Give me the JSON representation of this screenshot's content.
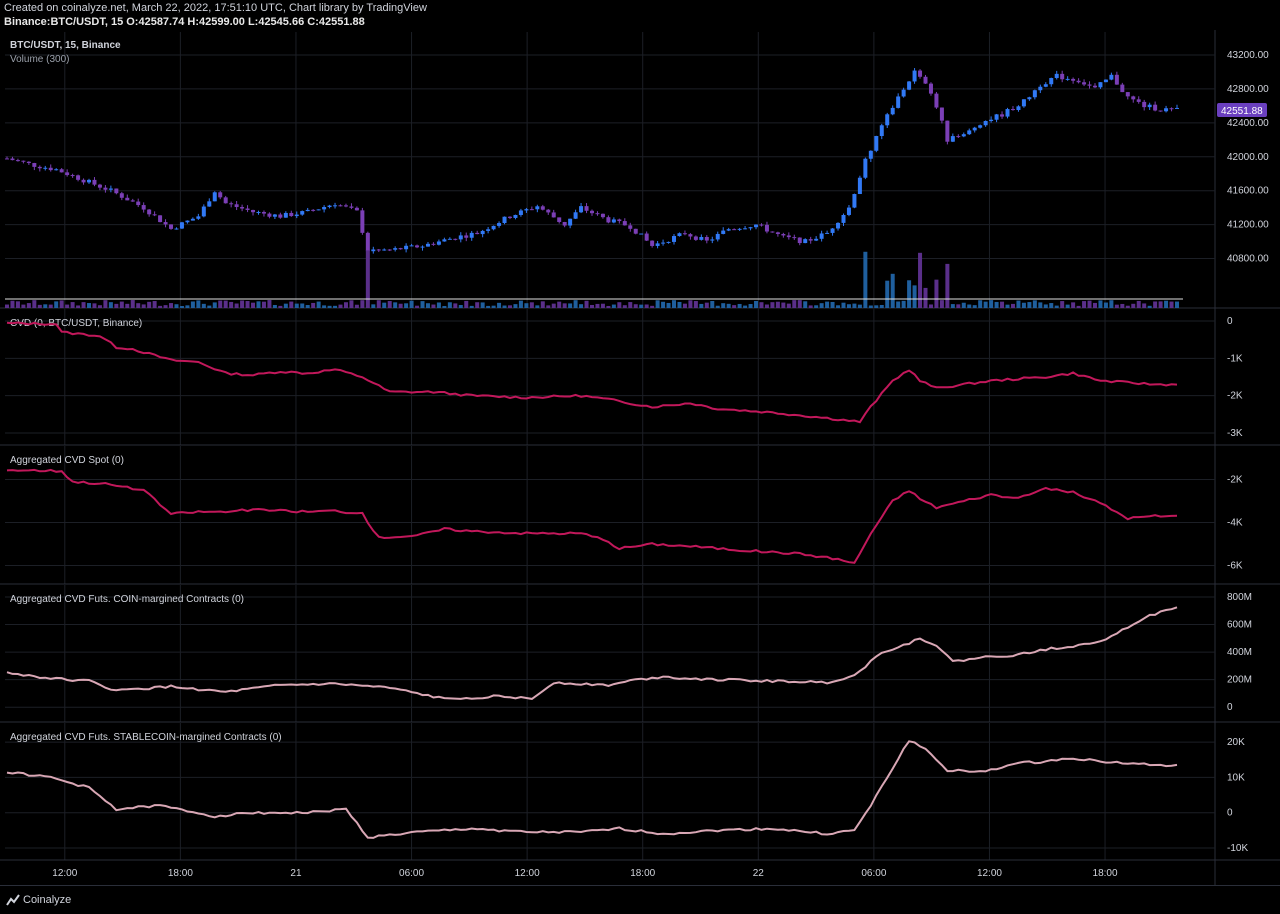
{
  "header": {
    "line1": "Created on coinalyze.net, March 22, 2022, 17:51:10 UTC, Chart library by TradingView",
    "line2": "Binance:BTC/USDT, 15 O:42587.74 H:42599.00 L:42545.66 C:42551.88"
  },
  "footer": {
    "brand": "Coinalyze"
  },
  "colors": {
    "background": "#000000",
    "grid": "#1c1f26",
    "text": "#d1d4dc",
    "candle_up": "#3179f5",
    "candle_down": "#7b3fb6",
    "vol_up": "#1f5f9e",
    "vol_down": "#5a2f8a",
    "cvd": "#c2185b",
    "coin": "#d9a7b5",
    "price_badge": "#6a3fbf"
  },
  "chart_data": [
    {
      "type": "candlestick",
      "title": "BTC/USDT, 15, Binance",
      "subtitle": "Volume (300)",
      "price_label": "42551.88",
      "ylim": [
        40500,
        43400
      ],
      "y_ticks": [
        "43200.00",
        "42800.00",
        "42400.00",
        "42000.00",
        "41600.00",
        "41200.00",
        "40800.00"
      ],
      "y_tick_values": [
        43200,
        42800,
        42400,
        42000,
        41600,
        41200,
        40800
      ],
      "anchors": [
        {
          "t": 0,
          "v": 41980
        },
        {
          "t": 5,
          "v": 41900
        },
        {
          "t": 9,
          "v": 41850
        },
        {
          "t": 15,
          "v": 41700
        },
        {
          "t": 19,
          "v": 41600
        },
        {
          "t": 25,
          "v": 41400
        },
        {
          "t": 30,
          "v": 41150
        },
        {
          "t": 35,
          "v": 41300
        },
        {
          "t": 38,
          "v": 41600
        },
        {
          "t": 40,
          "v": 41450
        },
        {
          "t": 45,
          "v": 41350
        },
        {
          "t": 50,
          "v": 41300
        },
        {
          "t": 55,
          "v": 41350
        },
        {
          "t": 60,
          "v": 41450
        },
        {
          "t": 64,
          "v": 41350
        },
        {
          "t": 66,
          "v": 40900
        },
        {
          "t": 70,
          "v": 40900
        },
        {
          "t": 76,
          "v": 40950
        },
        {
          "t": 82,
          "v": 41050
        },
        {
          "t": 86,
          "v": 41100
        },
        {
          "t": 92,
          "v": 41300
        },
        {
          "t": 97,
          "v": 41420
        },
        {
          "t": 102,
          "v": 41200
        },
        {
          "t": 105,
          "v": 41400
        },
        {
          "t": 110,
          "v": 41250
        },
        {
          "t": 114,
          "v": 41180
        },
        {
          "t": 118,
          "v": 40950
        },
        {
          "t": 124,
          "v": 41100
        },
        {
          "t": 128,
          "v": 41000
        },
        {
          "t": 132,
          "v": 41150
        },
        {
          "t": 137,
          "v": 41200
        },
        {
          "t": 142,
          "v": 41050
        },
        {
          "t": 146,
          "v": 41000
        },
        {
          "t": 150,
          "v": 41100
        },
        {
          "t": 154,
          "v": 41400
        },
        {
          "t": 157,
          "v": 41950
        },
        {
          "t": 161,
          "v": 42500
        },
        {
          "t": 164,
          "v": 42800
        },
        {
          "t": 166,
          "v": 43000
        },
        {
          "t": 168,
          "v": 42850
        },
        {
          "t": 170,
          "v": 42600
        },
        {
          "t": 172,
          "v": 42200
        },
        {
          "t": 175,
          "v": 42250
        },
        {
          "t": 178,
          "v": 42400
        },
        {
          "t": 182,
          "v": 42500
        },
        {
          "t": 186,
          "v": 42650
        },
        {
          "t": 189,
          "v": 42850
        },
        {
          "t": 192,
          "v": 42950
        },
        {
          "t": 196,
          "v": 42900
        },
        {
          "t": 199,
          "v": 42800
        },
        {
          "t": 202,
          "v": 42950
        },
        {
          "t": 205,
          "v": 42700
        },
        {
          "t": 208,
          "v": 42600
        },
        {
          "t": 211,
          "v": 42560
        },
        {
          "t": 214,
          "v": 42550
        }
      ]
    },
    {
      "type": "line",
      "title": "CVD (0, BTC/USDT, Binance)",
      "ylim": [
        -3000,
        0
      ],
      "y_ticks": [
        "0",
        "-1K",
        "-2K",
        "-3K"
      ],
      "y_tick_values": [
        0,
        -1000,
        -2000,
        -3000
      ],
      "points": [
        [
          0,
          -60
        ],
        [
          9,
          -80
        ],
        [
          10,
          -300
        ],
        [
          17,
          -400
        ],
        [
          20,
          -700
        ],
        [
          23,
          -750
        ],
        [
          30,
          -1050
        ],
        [
          35,
          -1100
        ],
        [
          40,
          -1400
        ],
        [
          45,
          -1450
        ],
        [
          50,
          -1350
        ],
        [
          55,
          -1400
        ],
        [
          60,
          -1300
        ],
        [
          65,
          -1500
        ],
        [
          70,
          -1900
        ],
        [
          78,
          -1900
        ],
        [
          85,
          -2000
        ],
        [
          95,
          -2050
        ],
        [
          105,
          -2000
        ],
        [
          110,
          -2100
        ],
        [
          118,
          -2300
        ],
        [
          125,
          -2200
        ],
        [
          130,
          -2350
        ],
        [
          140,
          -2450
        ],
        [
          150,
          -2600
        ],
        [
          156,
          -2700
        ],
        [
          158,
          -2300
        ],
        [
          162,
          -1600
        ],
        [
          165,
          -1300
        ],
        [
          167,
          -1600
        ],
        [
          170,
          -1800
        ],
        [
          175,
          -1700
        ],
        [
          180,
          -1600
        ],
        [
          185,
          -1550
        ],
        [
          190,
          -1500
        ],
        [
          195,
          -1400
        ],
        [
          200,
          -1600
        ],
        [
          205,
          -1650
        ],
        [
          210,
          -1700
        ],
        [
          214,
          -1700
        ]
      ]
    },
    {
      "type": "line",
      "title": "Aggregated CVD Spot (0)",
      "ylim": [
        -6300,
        -1000
      ],
      "y_ticks": [
        "-2K",
        "-4K",
        "-6K"
      ],
      "y_tick_values": [
        -2000,
        -4000,
        -6000
      ],
      "points": [
        [
          0,
          -1550
        ],
        [
          10,
          -1600
        ],
        [
          12,
          -2100
        ],
        [
          18,
          -2200
        ],
        [
          25,
          -2500
        ],
        [
          30,
          -3600
        ],
        [
          35,
          -3500
        ],
        [
          40,
          -3500
        ],
        [
          45,
          -3400
        ],
        [
          55,
          -3500
        ],
        [
          60,
          -3450
        ],
        [
          65,
          -3600
        ],
        [
          68,
          -4700
        ],
        [
          75,
          -4600
        ],
        [
          80,
          -4300
        ],
        [
          85,
          -4400
        ],
        [
          95,
          -4500
        ],
        [
          105,
          -4500
        ],
        [
          108,
          -4700
        ],
        [
          112,
          -5200
        ],
        [
          118,
          -5000
        ],
        [
          125,
          -5100
        ],
        [
          135,
          -5300
        ],
        [
          145,
          -5450
        ],
        [
          152,
          -5700
        ],
        [
          155,
          -5900
        ],
        [
          158,
          -4500
        ],
        [
          162,
          -3000
        ],
        [
          165,
          -2500
        ],
        [
          167,
          -2900
        ],
        [
          170,
          -3300
        ],
        [
          175,
          -3000
        ],
        [
          180,
          -2700
        ],
        [
          185,
          -2900
        ],
        [
          190,
          -2400
        ],
        [
          195,
          -2600
        ],
        [
          200,
          -3100
        ],
        [
          205,
          -3800
        ],
        [
          210,
          -3700
        ],
        [
          214,
          -3700
        ]
      ]
    },
    {
      "type": "line",
      "title": "Aggregated CVD Futs. COIN-margined Contracts (0)",
      "ylim": [
        -20,
        800
      ],
      "y_ticks": [
        "800M",
        "600M",
        "400M",
        "200M",
        "0"
      ],
      "y_tick_values": [
        800,
        600,
        400,
        200,
        0
      ],
      "points": [
        [
          0,
          250
        ],
        [
          8,
          210
        ],
        [
          15,
          190
        ],
        [
          20,
          120
        ],
        [
          30,
          150
        ],
        [
          40,
          110
        ],
        [
          50,
          160
        ],
        [
          60,
          170
        ],
        [
          70,
          140
        ],
        [
          80,
          60
        ],
        [
          90,
          80
        ],
        [
          96,
          60
        ],
        [
          100,
          180
        ],
        [
          110,
          160
        ],
        [
          115,
          200
        ],
        [
          120,
          220
        ],
        [
          130,
          200
        ],
        [
          140,
          190
        ],
        [
          150,
          180
        ],
        [
          155,
          230
        ],
        [
          160,
          400
        ],
        [
          164,
          450
        ],
        [
          167,
          500
        ],
        [
          170,
          450
        ],
        [
          173,
          330
        ],
        [
          178,
          360
        ],
        [
          185,
          380
        ],
        [
          190,
          420
        ],
        [
          196,
          450
        ],
        [
          200,
          480
        ],
        [
          204,
          560
        ],
        [
          208,
          650
        ],
        [
          212,
          700
        ],
        [
          214,
          720
        ]
      ]
    },
    {
      "type": "line",
      "title": "Aggregated CVD Futs. STABLECOIN-margined Contracts (0)",
      "ylim": [
        -10000,
        22000
      ],
      "y_ticks": [
        "20K",
        "10K",
        "0",
        "-10K"
      ],
      "y_tick_values": [
        20000,
        10000,
        0,
        -10000
      ],
      "points": [
        [
          0,
          11500
        ],
        [
          8,
          10000
        ],
        [
          15,
          7000
        ],
        [
          20,
          1000
        ],
        [
          28,
          2000
        ],
        [
          38,
          -1000
        ],
        [
          45,
          0
        ],
        [
          55,
          0
        ],
        [
          62,
          1000
        ],
        [
          66,
          -7000
        ],
        [
          75,
          -5500
        ],
        [
          85,
          -4500
        ],
        [
          95,
          -5500
        ],
        [
          105,
          -5500
        ],
        [
          112,
          -4500
        ],
        [
          120,
          -6000
        ],
        [
          130,
          -5000
        ],
        [
          140,
          -4500
        ],
        [
          150,
          -6000
        ],
        [
          155,
          -5000
        ],
        [
          158,
          2000
        ],
        [
          161,
          10000
        ],
        [
          165,
          20500
        ],
        [
          168,
          18000
        ],
        [
          172,
          12000
        ],
        [
          178,
          11500
        ],
        [
          185,
          14000
        ],
        [
          190,
          14500
        ],
        [
          195,
          15500
        ],
        [
          200,
          14500
        ],
        [
          205,
          14000
        ],
        [
          210,
          13500
        ],
        [
          214,
          13200
        ]
      ]
    }
  ],
  "x_axis": {
    "labels": [
      "12:00",
      "18:00",
      "21",
      "06:00",
      "12:00",
      "18:00",
      "22",
      "06:00",
      "12:00",
      "18:00"
    ],
    "positions": [
      12,
      36,
      60,
      84,
      108,
      132,
      156,
      180,
      204,
      228
    ]
  }
}
